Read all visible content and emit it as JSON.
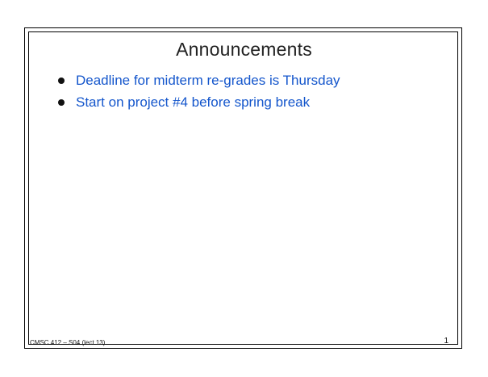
{
  "slide": {
    "title": "Announcements",
    "bullets": [
      "Deadline for midterm re-grades is Thursday",
      "Start on project #4 before spring break"
    ],
    "footer_left": "CMSC 412 – S04 (lect 13)",
    "page_number": "1"
  },
  "colors": {
    "bullet_text": "#1456cc",
    "title_text": "#222222",
    "border": "#000000"
  }
}
